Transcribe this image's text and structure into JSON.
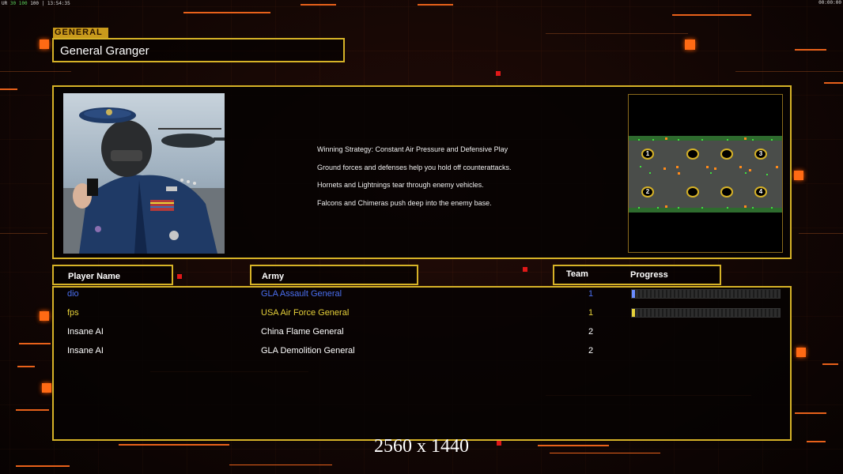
{
  "hud": {
    "top_left_prefix": "UR",
    "fps": "30",
    "stats": "100",
    "stats_dim": "100",
    "clock": "13:54:35",
    "top_right_clock": "00:00:00"
  },
  "general": {
    "tag": "GENERAL",
    "name": "General Granger"
  },
  "strategy": [
    "Winning Strategy: Constant Air Pressure and Defensive Play",
    "Ground forces and defenses help you hold off counterattacks.",
    "Hornets and Lightnings tear through enemy vehicles.",
    "Falcons and Chimeras push deep into the enemy base."
  ],
  "map": {
    "slots": [
      "1",
      "",
      "",
      "3",
      "2",
      "",
      "",
      "4"
    ]
  },
  "table": {
    "headers": {
      "player_name": "Player Name",
      "army": "Army",
      "team": "Team",
      "progress": "Progress"
    },
    "rows": [
      {
        "name": "dio",
        "army": "GLA Assault General",
        "team": "1",
        "color": "#4a6ff0",
        "progress": 0.01,
        "fill_color": "#6a8cff"
      },
      {
        "name": "fps",
        "army": "USA Air Force General",
        "team": "1",
        "color": "#e6d13a",
        "progress": 0.02,
        "fill_color": "#e6d13a"
      },
      {
        "name": "Insane AI",
        "army": "China Flame General",
        "team": "2",
        "color": "#ffffff",
        "progress": null,
        "fill_color": ""
      },
      {
        "name": "Insane AI",
        "army": "GLA Demolition General",
        "team": "2",
        "color": "#ffffff",
        "progress": null,
        "fill_color": ""
      }
    ]
  },
  "resolution_text": "2560 x 1440",
  "colors": {
    "accent_gold": "#d6b227",
    "accent_orange": "#ff6a14",
    "background": "#120605"
  }
}
